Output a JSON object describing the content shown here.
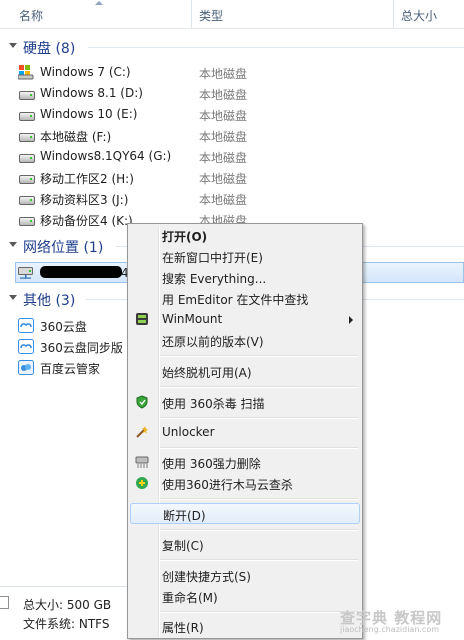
{
  "columns": {
    "name": "名称",
    "type": "类型",
    "size": "总大小"
  },
  "groups": {
    "hard_disk": "硬盘 (8)",
    "network": "网络位置 (1)",
    "other": "其他 (3)"
  },
  "drives": [
    {
      "name": "Windows 7 (C:)",
      "type": "本地磁盘",
      "icon": "system-drive-icon"
    },
    {
      "name": "Windows 8.1 (D:)",
      "type": "本地磁盘",
      "icon": "hard-drive-icon"
    },
    {
      "name": "Windows 10 (E:)",
      "type": "本地磁盘",
      "icon": "hard-drive-icon"
    },
    {
      "name": "本地磁盘 (F:)",
      "type": "本地磁盘",
      "icon": "hard-drive-icon"
    },
    {
      "name": "Windows8.1QY64 (G:)",
      "type": "本地磁盘",
      "icon": "hard-drive-icon"
    },
    {
      "name": "移动工作区2 (H:)",
      "type": "本地磁盘",
      "icon": "hard-drive-icon"
    },
    {
      "name": "移动资料区3 (J:)",
      "type": "本地磁盘",
      "icon": "hard-drive-icon"
    },
    {
      "name": "移动备份区4 (K:)",
      "type": "本地磁盘",
      "icon": "hard-drive-icon"
    }
  ],
  "network_items": [
    {
      "name_suffix": "4",
      "icon": "network-drive-icon"
    }
  ],
  "other_items": [
    {
      "name": "360云盘",
      "icon": "cloud-icon"
    },
    {
      "name": "360云盘同步版",
      "icon": "cloud-icon"
    },
    {
      "name": "百度云管家",
      "icon": "baidu-cloud-icon"
    }
  ],
  "status": {
    "total_size": "总大小: 500 GB",
    "file_system": "文件系统: NTFS"
  },
  "context_menu": {
    "open": "打开(O)",
    "open_new_window": "在新窗口中打开(E)",
    "search_everything": "搜索 Everything...",
    "emeditor": "用 EmEditor 在文件中查找",
    "winmount": "WinMount",
    "restore": "还原以前的版本(V)",
    "offline": "始终脱机可用(A)",
    "scan_360": "使用 360杀毒 扫描",
    "unlocker": "Unlocker",
    "delete_360": "使用 360强力删除",
    "trojan_360": "使用360进行木马云查杀",
    "disconnect": "断开(D)",
    "copy": "复制(C)",
    "shortcut": "创建快捷方式(S)",
    "rename": "重命名(M)",
    "properties": "属性(R)"
  },
  "watermark": {
    "main": "查字典 教程网",
    "url": "jiaocheng.chazidian.com"
  },
  "colors": {
    "group_header": "#1f3e8c",
    "selection": "#d4e6fa",
    "menu_bg": "#f0f0f0"
  }
}
